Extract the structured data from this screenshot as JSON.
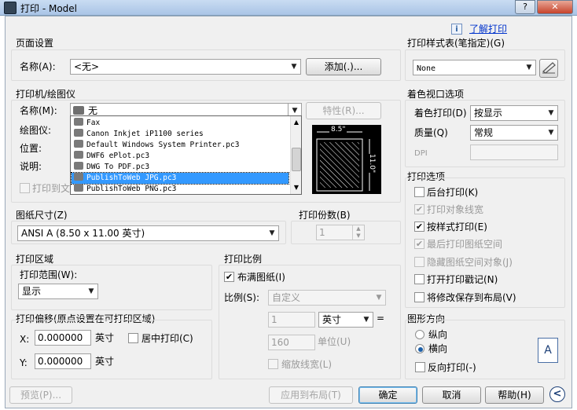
{
  "window": {
    "title": "打印 - Model",
    "help_btn": "?",
    "close_btn": "✕"
  },
  "help_link": "了解打印",
  "page_setup": {
    "title": "页面设置",
    "name_label": "名称(A):",
    "name_value": "<无>",
    "add_button": "添加(.)..."
  },
  "printer": {
    "title": "打印机/绘图仪",
    "name_label": "名称(M):",
    "name_value": "无",
    "properties_button": "特性(R)...",
    "plotter_label": "绘图仪:",
    "location_label": "位置:",
    "description_label": "说明:",
    "print_to_file_label": "打印到文",
    "dropdown_items": [
      "Fax",
      "Canon Inkjet iP1100 series",
      "Default Windows System Printer.pc3",
      "DWF6 ePlot.pc3",
      "DWG To PDF.pc3",
      "PublishToWeb JPG.pc3",
      "PublishToWeb PNG.pc3"
    ],
    "selected_index": 5,
    "preview_width": "8.5\"",
    "preview_height": "11.0\""
  },
  "paper_size": {
    "title": "图纸尺寸(Z)",
    "value": "ANSI A (8.50 x 11.00 英寸)"
  },
  "copies": {
    "title": "打印份数(B)",
    "value": "1"
  },
  "plot_area": {
    "title": "打印区域",
    "range_label": "打印范围(W):",
    "range_value": "显示"
  },
  "plot_offset": {
    "title": "打印偏移(原点设置在可打印区域)",
    "x_label": "X:",
    "x_value": "0.000000",
    "x_unit": "英寸",
    "y_label": "Y:",
    "y_value": "0.000000",
    "y_unit": "英寸",
    "center_label": "居中打印(C)"
  },
  "plot_scale": {
    "title": "打印比例",
    "fit_label": "布满图纸(I)",
    "fit_checked": true,
    "scale_label": "比例(S):",
    "scale_value": "自定义",
    "value1": "1",
    "unit_value": "英寸",
    "equals": "=",
    "value2": "160",
    "unit2_label": "单位(U)",
    "lineweights_label": "缩放线宽(L)"
  },
  "plot_style_table": {
    "title": "打印样式表(笔指定)(G)",
    "value": "None"
  },
  "shaded_viewport": {
    "title": "着色视口选项",
    "shade_label": "着色打印(D)",
    "shade_value": "按显示",
    "quality_label": "质量(Q)",
    "quality_value": "常规",
    "dpi_label": "DPI"
  },
  "plot_options": {
    "title": "打印选项",
    "items": [
      {
        "label": "后台打印(K)",
        "checked": false,
        "enabled": true
      },
      {
        "label": "打印对象线宽",
        "checked": true,
        "enabled": false
      },
      {
        "label": "按样式打印(E)",
        "checked": true,
        "enabled": true
      },
      {
        "label": "最后打印图纸空间",
        "checked": true,
        "enabled": false
      },
      {
        "label": "隐藏图纸空间对象(J)",
        "checked": false,
        "enabled": false
      },
      {
        "label": "打开打印戳记(N)",
        "checked": false,
        "enabled": true
      },
      {
        "label": "将修改保存到布局(V)",
        "checked": false,
        "enabled": true
      }
    ]
  },
  "orientation": {
    "title": "图形方向",
    "portrait_label": "纵向",
    "landscape_label": "横向",
    "upside_down_label": "反向打印(-)",
    "selected": "landscape",
    "icon_letter": "A"
  },
  "footer": {
    "preview_button": "预览(P)...",
    "apply_button": "应用到布局(T)",
    "ok_button": "确定",
    "cancel_button": "取消",
    "help_button": "帮助(H)",
    "more_button": "<"
  }
}
